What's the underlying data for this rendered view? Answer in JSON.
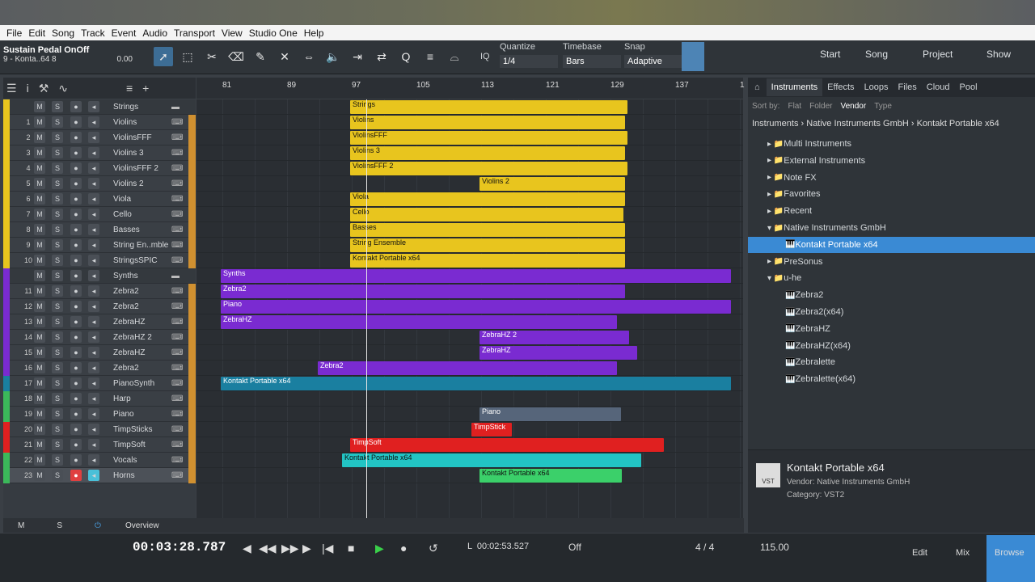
{
  "menu": [
    "File",
    "Edit",
    "Song",
    "Track",
    "Event",
    "Audio",
    "Transport",
    "View",
    "Studio One",
    "Help"
  ],
  "toolbar": {
    "info_title": "Sustain Pedal OnOff",
    "info_track": "9 - Konta..64 8",
    "info_value": "0.00",
    "quantize_label": "Quantize",
    "quantize_value": "1/4",
    "timebase_label": "Timebase",
    "timebase_value": "Bars",
    "snap_label": "Snap",
    "snap_value": "Adaptive",
    "iq_label": "IQ",
    "start": "Start",
    "song": "Song",
    "project": "Project",
    "show": "Show"
  },
  "ruler": [
    "81",
    "89",
    "97",
    "105",
    "113",
    "121",
    "129",
    "137",
    "1"
  ],
  "tracks": [
    {
      "num": "",
      "name": "Strings",
      "color": "#e8c51e",
      "folder": true
    },
    {
      "num": "1",
      "name": "Violins",
      "color": "#e8c51e"
    },
    {
      "num": "2",
      "name": "ViolinsFFF",
      "color": "#e8c51e"
    },
    {
      "num": "3",
      "name": "Violins 3",
      "color": "#e8c51e"
    },
    {
      "num": "4",
      "name": "ViolinsFFF 2",
      "color": "#e8c51e"
    },
    {
      "num": "5",
      "name": "Violins 2",
      "color": "#e8c51e"
    },
    {
      "num": "6",
      "name": "Viola",
      "color": "#e8c51e"
    },
    {
      "num": "7",
      "name": "Cello",
      "color": "#e8c51e"
    },
    {
      "num": "8",
      "name": "Basses",
      "color": "#e8c51e"
    },
    {
      "num": "9",
      "name": "String En..mble",
      "color": "#e8c51e"
    },
    {
      "num": "10",
      "name": "StringsSPIC",
      "color": "#e8c51e"
    },
    {
      "num": "",
      "name": "Synths",
      "color": "#7a2bd1",
      "folder": true
    },
    {
      "num": "11",
      "name": "Zebra2",
      "color": "#7a2bd1"
    },
    {
      "num": "12",
      "name": "Zebra2",
      "color": "#7a2bd1"
    },
    {
      "num": "13",
      "name": "ZebraHZ",
      "color": "#7a2bd1"
    },
    {
      "num": "14",
      "name": "ZebraHZ 2",
      "color": "#7a2bd1"
    },
    {
      "num": "15",
      "name": "ZebraHZ",
      "color": "#7a2bd1"
    },
    {
      "num": "16",
      "name": "Zebra2",
      "color": "#7a2bd1"
    },
    {
      "num": "17",
      "name": "PianoSynth",
      "color": "#1a7fa0"
    },
    {
      "num": "18",
      "name": "Harp",
      "color": "#3bb85a"
    },
    {
      "num": "19",
      "name": "Piano",
      "color": "#3bb85a"
    },
    {
      "num": "20",
      "name": "TimpSticks",
      "color": "#e02020"
    },
    {
      "num": "21",
      "name": "TimpSoft",
      "color": "#e02020"
    },
    {
      "num": "22",
      "name": "Vocals",
      "color": "#3bb85a"
    },
    {
      "num": "23",
      "name": "Horns",
      "color": "#3bb85a",
      "selected": true
    }
  ],
  "clips": [
    {
      "lane": 0,
      "label": "Strings",
      "color": "#e8c51e",
      "start": 190,
      "end": 533
    },
    {
      "lane": 1,
      "label": "Violins",
      "color": "#e8c51e",
      "start": 190,
      "end": 530
    },
    {
      "lane": 2,
      "label": "ViolinsFFF",
      "color": "#e8c51e",
      "start": 190,
      "end": 533
    },
    {
      "lane": 3,
      "label": "Violins 3",
      "color": "#e8c51e",
      "start": 190,
      "end": 530
    },
    {
      "lane": 4,
      "label": "ViolinsFFF 2",
      "color": "#e8c51e",
      "start": 190,
      "end": 533
    },
    {
      "lane": 5,
      "label": "Violins 2",
      "color": "#e8c51e",
      "start": 350,
      "end": 530
    },
    {
      "lane": 6,
      "label": "Viola",
      "color": "#e8c51e",
      "start": 190,
      "end": 530
    },
    {
      "lane": 7,
      "label": "Cello",
      "color": "#e8c51e",
      "start": 190,
      "end": 528
    },
    {
      "lane": 8,
      "label": "Basses",
      "color": "#e8c51e",
      "start": 190,
      "end": 530
    },
    {
      "lane": 9,
      "label": "String Ensemble",
      "color": "#e8c51e",
      "start": 190,
      "end": 530
    },
    {
      "lane": 10,
      "label": "Kontakt Portable x64",
      "color": "#e8c51e",
      "start": 190,
      "end": 530
    },
    {
      "lane": 11,
      "label": "Synths",
      "color": "#7a2bd1",
      "start": 30,
      "end": 661
    },
    {
      "lane": 12,
      "label": "Zebra2",
      "color": "#7a2bd1",
      "start": 30,
      "end": 530
    },
    {
      "lane": 13,
      "label": "Piano",
      "color": "#7a2bd1",
      "start": 30,
      "end": 661
    },
    {
      "lane": 14,
      "label": "ZebraHZ",
      "color": "#7a2bd1",
      "start": 30,
      "end": 520
    },
    {
      "lane": 15,
      "label": "ZebraHZ 2",
      "color": "#7a2bd1",
      "start": 350,
      "end": 535
    },
    {
      "lane": 16,
      "label": "ZebraHZ",
      "color": "#7a2bd1",
      "start": 350,
      "end": 545
    },
    {
      "lane": 17,
      "label": "Zebra2",
      "color": "#7a2bd1",
      "start": 150,
      "end": 520
    },
    {
      "lane": 18,
      "label": "Kontakt Portable x64",
      "color": "#1a7fa0",
      "start": 30,
      "end": 661
    },
    {
      "lane": 20,
      "label": "Piano",
      "color": "#56657a",
      "start": 350,
      "end": 525
    },
    {
      "lane": 21,
      "label": "TimpStick",
      "color": "#e02020",
      "start": 340,
      "end": 390
    },
    {
      "lane": 22,
      "label": "TimpSoft",
      "color": "#e02020",
      "start": 190,
      "end": 578
    },
    {
      "lane": 23,
      "label": "Kontakt Portable x64",
      "color": "#22c4c4",
      "start": 180,
      "end": 550
    },
    {
      "lane": 24,
      "label": "Kontakt Portable x64",
      "color": "#3bd06a",
      "start": 350,
      "end": 526
    }
  ],
  "bottom": {
    "m": "M",
    "s": "S",
    "overview": "Overview"
  },
  "transport": {
    "time": "00:03:28.787",
    "loop_l": "00:02:53.527",
    "off": "Off",
    "sig": "4 / 4",
    "tempo": "115.00",
    "edit": "Edit",
    "mix": "Mix",
    "browse": "Browse"
  },
  "browser": {
    "tabs": [
      "Instruments",
      "Effects",
      "Loops",
      "Files",
      "Cloud",
      "Pool"
    ],
    "sortby_label": "Sort by:",
    "sortby": [
      "Flat",
      "Folder",
      "Vendor",
      "Type"
    ],
    "crumbs": [
      "Instruments",
      "Native Instruments GmbH",
      "Kontakt Portable x64"
    ],
    "items": [
      {
        "label": "Multi Instruments",
        "indent": 1,
        "arrow": "▸"
      },
      {
        "label": "External Instruments",
        "indent": 1,
        "arrow": "▸"
      },
      {
        "label": "Note FX",
        "indent": 1,
        "arrow": "▸"
      },
      {
        "label": "Favorites",
        "indent": 1,
        "arrow": "▸"
      },
      {
        "label": "Recent",
        "indent": 1,
        "arrow": "▸"
      },
      {
        "label": "Native Instruments GmbH",
        "indent": 1,
        "arrow": "▾"
      },
      {
        "label": "Kontakt Portable x64",
        "indent": 2,
        "arrow": "",
        "selected": true
      },
      {
        "label": "PreSonus",
        "indent": 1,
        "arrow": "▸"
      },
      {
        "label": "u-he",
        "indent": 1,
        "arrow": "▾"
      },
      {
        "label": "Zebra2",
        "indent": 2,
        "arrow": ""
      },
      {
        "label": "Zebra2(x64)",
        "indent": 2,
        "arrow": ""
      },
      {
        "label": "ZebraHZ",
        "indent": 2,
        "arrow": ""
      },
      {
        "label": "ZebraHZ(x64)",
        "indent": 2,
        "arrow": ""
      },
      {
        "label": "Zebralette",
        "indent": 2,
        "arrow": ""
      },
      {
        "label": "Zebralette(x64)",
        "indent": 2,
        "arrow": ""
      }
    ],
    "info_name": "Kontakt Portable x64",
    "info_vendor": "Vendor:      Native Instruments GmbH",
    "info_category": "Category:    VST2",
    "vst": "VST"
  }
}
